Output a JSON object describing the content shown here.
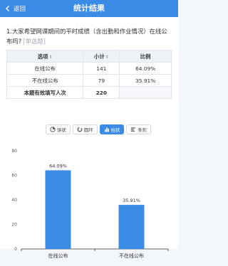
{
  "header": {
    "back_label": "返回",
    "title": "统计结果"
  },
  "question": {
    "text": "1.大家希望网课期间的平时成绩（含出勤和作业情况）在线公布吗?",
    "type": "[单选题]"
  },
  "table": {
    "headers": {
      "option": "选项",
      "count": "小计",
      "percent": "比例"
    },
    "rows": [
      {
        "option": "在线公布",
        "count": "141",
        "percent": "64.09%"
      },
      {
        "option": "不在线公布",
        "count": "79",
        "percent": "35.91%"
      }
    ],
    "total_label": "本题有效填写人次",
    "total_value": "220"
  },
  "chart_toggle": {
    "pie": "饼状",
    "ring": "圆环",
    "bar": "柱状",
    "strip": "条形",
    "active": "bar"
  },
  "colors": {
    "accent": "#3a8be5",
    "bar": "#3a8be5"
  },
  "chart_data": {
    "type": "bar",
    "categories": [
      "在线公布",
      "不在线公布"
    ],
    "values": [
      64.09,
      35.91
    ],
    "value_labels": [
      "64.09%",
      "35.91%"
    ],
    "ylim": [
      0,
      80
    ],
    "yticks": [
      0,
      20,
      40,
      60,
      80
    ],
    "ytick_labels": [
      "0",
      "20",
      "40",
      "60",
      "80"
    ],
    "grid": false,
    "title": "",
    "xlabel": "",
    "ylabel": ""
  }
}
